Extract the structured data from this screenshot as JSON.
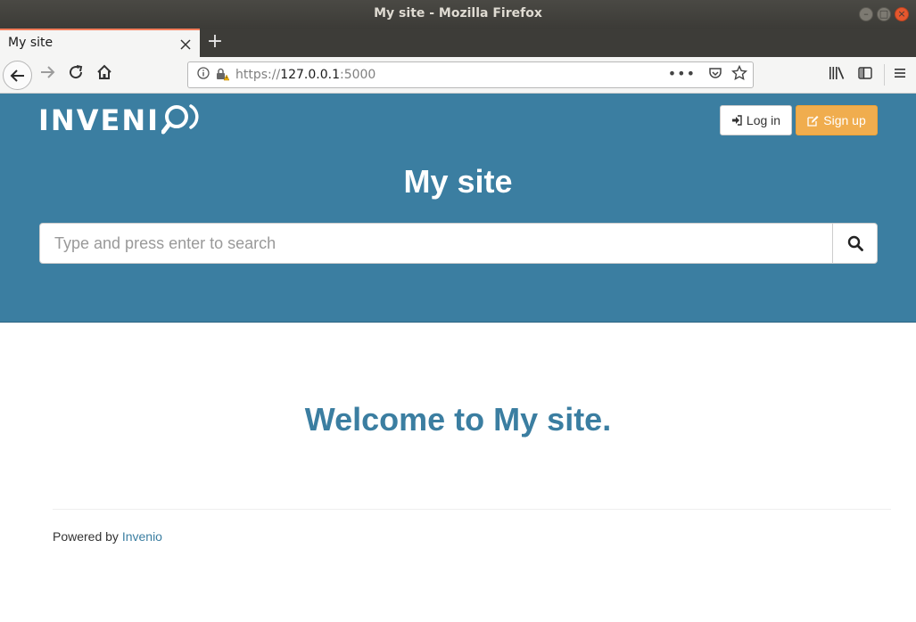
{
  "window": {
    "title": "My site - Mozilla Firefox",
    "controls": {
      "minimize": "–",
      "maximize": "□",
      "close": "×"
    }
  },
  "tabs": [
    {
      "label": "My site",
      "active": true
    }
  ],
  "newtab": {
    "label": "+"
  },
  "address_bar": {
    "scheme": "https://",
    "host": "127.0.0.1",
    "port": ":5000",
    "more": "•••"
  },
  "site": {
    "logo_text": "INVENI",
    "title": "My site",
    "login_label": "Log in",
    "signup_label": "Sign up",
    "search_placeholder": "Type and press enter to search"
  },
  "main": {
    "welcome": "Welcome to My site."
  },
  "footer": {
    "prefix": "Powered by",
    "link_text": "Invenio"
  },
  "colors": {
    "brand": "#3b7ea1",
    "signup": "#f0ad4e",
    "tab_accent": "#f47d5a"
  }
}
